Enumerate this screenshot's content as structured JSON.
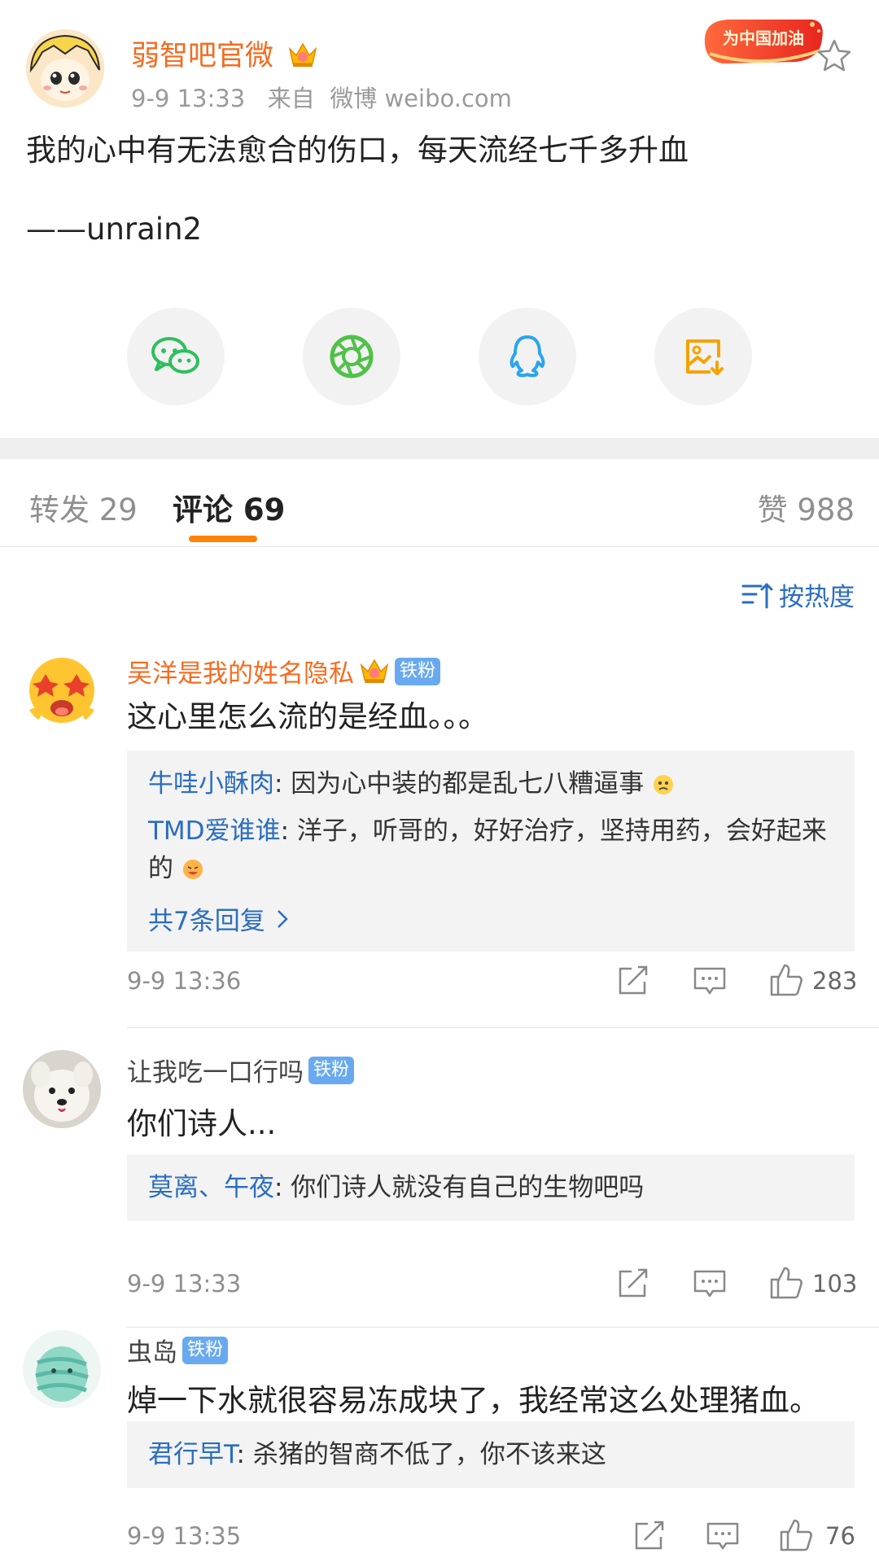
{
  "post": {
    "author": "弱智吧官微",
    "meta": "9-9 13:33   来自  微博 weibo.com",
    "promo_text": "为中国加油",
    "text": "我的心中有无法愈合的伤口，每天流经七千多升血",
    "signature": "——unrain2",
    "share_icons": [
      "wechat-icon",
      "moments-icon",
      "qq-icon",
      "save-image-icon"
    ]
  },
  "tabs": {
    "repost": "转发 29",
    "comments": "评论 69",
    "likes": "赞 988"
  },
  "sort": {
    "label": "按热度"
  },
  "comments": [
    {
      "name": "吴洋是我的姓名隐私",
      "badge": "铁粉",
      "text": "这心里怎么流的是经血。。。",
      "replies": [
        {
          "who": "牛哇小酥肉",
          "text": ": 因为心中装的都是乱七八糟逼事"
        },
        {
          "who": "TMD爱谁谁",
          "text": ": 洋子，听哥的，好好治疗，坚持用药，会好起来的"
        }
      ],
      "more": "共7条回复",
      "time": "9-9 13:36",
      "likes": "283"
    },
    {
      "name": "让我吃一口行吗",
      "badge": "铁粉",
      "text": "你们诗人...",
      "replies": [
        {
          "who": "莫离、午夜",
          "text": ": 你们诗人就没有自己的生物吧吗"
        }
      ],
      "time": "9-9 13:33",
      "likes": "103"
    },
    {
      "name": "虫岛",
      "badge": "铁粉",
      "text": "焯一下水就很容易冻成块了，我经常这么处理猪血。",
      "replies": [
        {
          "who": "君行早T",
          "text": ": 杀猪的智商不低了，你不该来这"
        }
      ],
      "time": "9-9 13:35",
      "likes": "76"
    }
  ],
  "colors": {
    "accent_orange": "#f46b1f",
    "link_blue": "#2a6dc0",
    "tab_underline": "#ff8200",
    "fan_badge": "#69a9f0"
  }
}
